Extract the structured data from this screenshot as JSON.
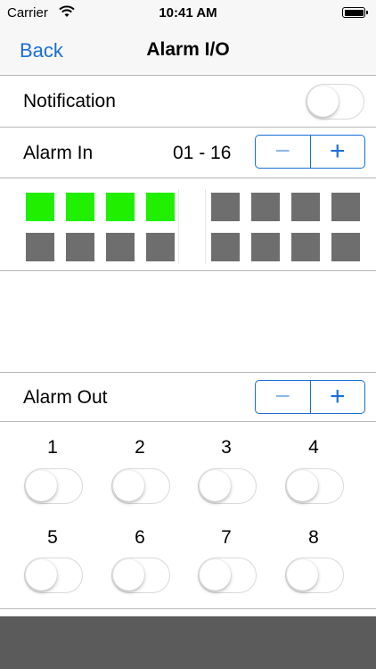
{
  "status_bar": {
    "carrier": "Carrier",
    "time": "10:41 AM"
  },
  "nav": {
    "back_label": "Back",
    "title": "Alarm I/O"
  },
  "notification": {
    "label": "Notification",
    "enabled": false
  },
  "alarm_in": {
    "label": "Alarm In",
    "range": "01 - 16",
    "stepper": {
      "minus": "−",
      "plus": "+"
    },
    "states": [
      true,
      true,
      true,
      true,
      false,
      false,
      false,
      false,
      false,
      false,
      false,
      false,
      false,
      false,
      false,
      false
    ],
    "colors": {
      "on": "#20f000",
      "off": "#6e6e6e"
    }
  },
  "alarm_out": {
    "label": "Alarm Out",
    "stepper": {
      "minus": "−",
      "plus": "+"
    },
    "outputs": [
      {
        "number": "1",
        "on": false
      },
      {
        "number": "2",
        "on": false
      },
      {
        "number": "3",
        "on": false
      },
      {
        "number": "4",
        "on": false
      },
      {
        "number": "5",
        "on": false
      },
      {
        "number": "6",
        "on": false
      },
      {
        "number": "7",
        "on": false
      },
      {
        "number": "8",
        "on": false
      }
    ]
  },
  "accent_color": "#1a6fd6"
}
